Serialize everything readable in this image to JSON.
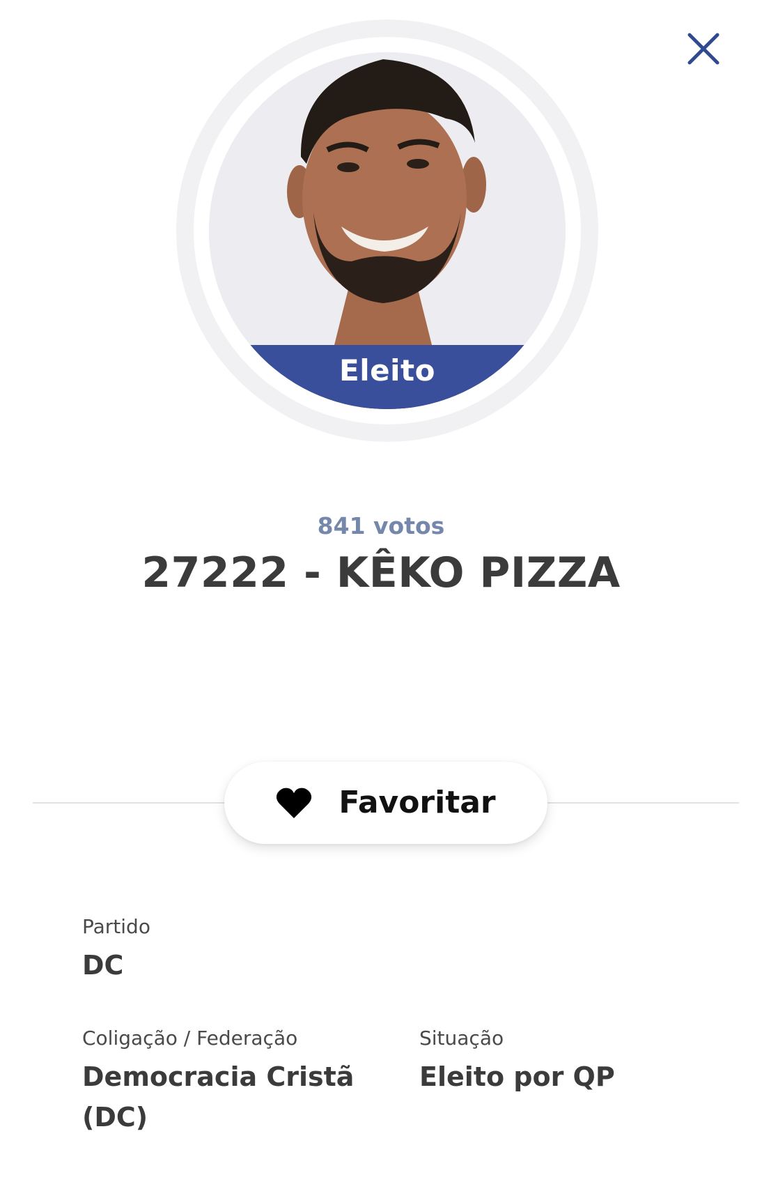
{
  "header": {
    "close_icon": "close-icon"
  },
  "candidate": {
    "photo": "candidate-photo",
    "status_badge": "Eleito",
    "votes": "841 votos",
    "name": "27222 - KÊKO PIZZA"
  },
  "actions": {
    "favorite_label": "Favoritar",
    "favorite_icon": "heart-icon"
  },
  "details": {
    "partido": {
      "label": "Partido",
      "value": "DC"
    },
    "coligacao": {
      "label": "Coligação / Federação",
      "value": "Democracia Cristã (DC)"
    },
    "situacao": {
      "label": "Situação",
      "value": "Eleito por QP"
    }
  },
  "colors": {
    "accent": "#3a4f9b",
    "votes_text": "#7587ab",
    "name_text": "#3b3b3b",
    "close_icon": "#2f4a8f"
  }
}
